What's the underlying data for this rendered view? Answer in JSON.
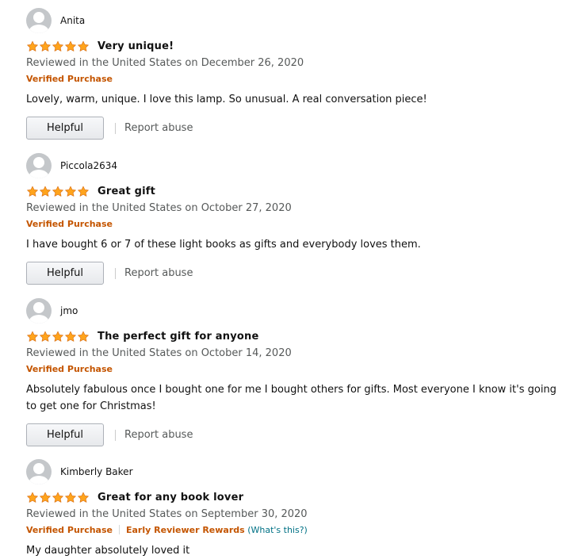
{
  "reviews": [
    {
      "name": "Anita",
      "stars": 5,
      "title": "Very unique!",
      "date": "Reviewed in the United States on December 26, 2020",
      "verified": "Verified Purchase",
      "body": "Lovely, warm, unique. I love this lamp. So unusual. A real conversation piece!",
      "helpful_label": "Helpful",
      "report_label": "Report abuse"
    },
    {
      "name": "Piccola2634",
      "stars": 5,
      "title": "Great gift",
      "date": "Reviewed in the United States on October 27, 2020",
      "verified": "Verified Purchase",
      "body": "I have bought 6 or 7 of these light books as gifts and everybody loves them.",
      "helpful_label": "Helpful",
      "report_label": "Report abuse"
    },
    {
      "name": "jmo",
      "stars": 5,
      "title": "The perfect gift for anyone",
      "date": "Reviewed in the United States on October 14, 2020",
      "verified": "Verified Purchase",
      "body": "Absolutely fabulous once I bought one for me I bought others for gifts. Most everyone I know it's going to get one for Christmas!",
      "helpful_label": "Helpful",
      "report_label": "Report abuse"
    },
    {
      "name": "Kimberly Baker",
      "stars": 5,
      "title": "Great for any book lover",
      "date": "Reviewed in the United States on September 30, 2020",
      "verified": "Verified Purchase",
      "early_reviewer": "Early Reviewer Rewards",
      "whats_this": "(What's this?)",
      "body": "My daughter absolutely loved it"
    }
  ],
  "colors": {
    "star": "#ffa41c",
    "star_outline": "#de7921",
    "verified": "#c45500",
    "link": "#007185",
    "secondary_text": "#565959"
  }
}
